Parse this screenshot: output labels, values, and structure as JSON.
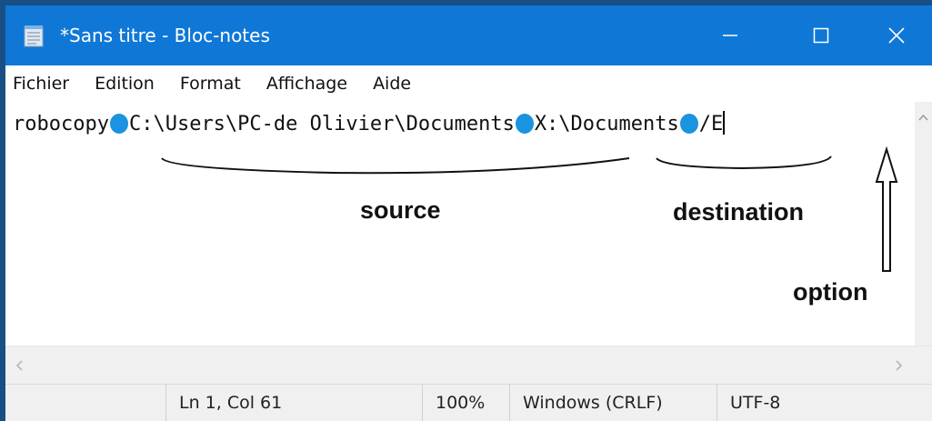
{
  "window": {
    "title": "*Sans titre - Bloc-notes",
    "minimize_icon": "minimize-icon",
    "maximize_icon": "maximize-icon",
    "close_icon": "close-icon"
  },
  "menu": [
    "Fichier",
    "Edition",
    "Format",
    "Affichage",
    "Aide"
  ],
  "editor": {
    "command": "robocopy",
    "source": "C:\\Users\\PC-de Olivier\\Documents",
    "destination": "X:\\Documents",
    "option": "/E"
  },
  "annotations": {
    "source_label": "source",
    "destination_label": "destination",
    "option_label": "option"
  },
  "statusbar": {
    "position": "Ln 1, Col 61",
    "zoom": "100%",
    "line_ending": "Windows (CRLF)",
    "encoding": "UTF-8"
  },
  "colors": {
    "titlebar": "#0f78d7",
    "space_marker": "#1a93e0"
  }
}
